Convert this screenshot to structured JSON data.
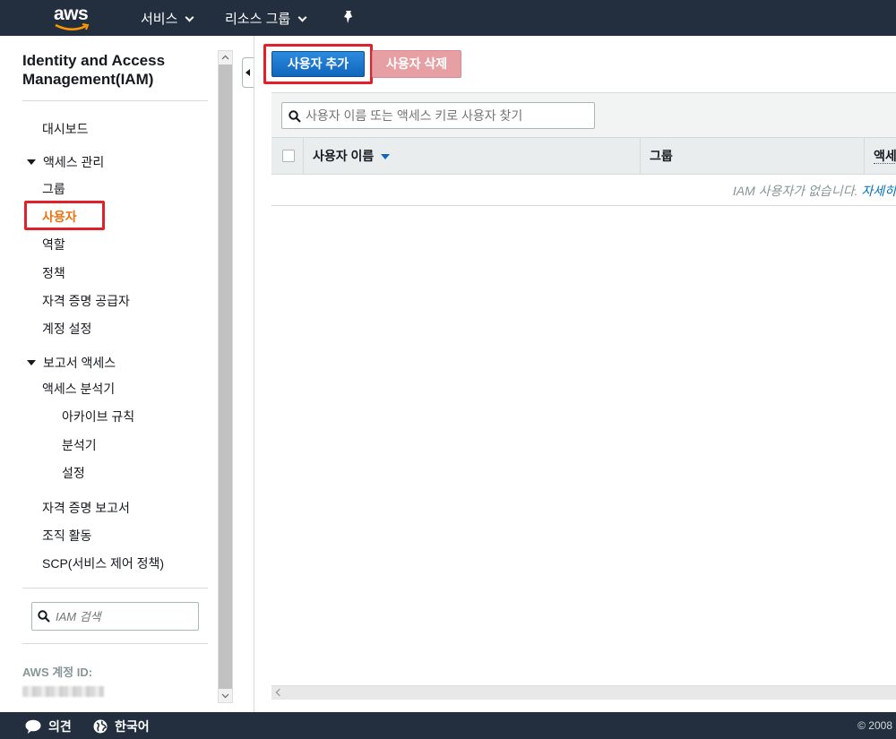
{
  "topbar": {
    "logo": "aws",
    "services": "서비스",
    "resource_groups": "리소스 그룹"
  },
  "sidebar": {
    "title": "Identity and Access Management(IAM)",
    "dashboard": "대시보드",
    "access_mgmt": "액세스 관리",
    "access_items": [
      "그룹",
      "사용자",
      "역할",
      "정책",
      "자격 증명 공급자",
      "계정 설정"
    ],
    "active_item": "사용자",
    "report_access": "보고서 액세스",
    "analyzer": "액세스 분석기",
    "analyzer_items": [
      "아카이브 규칙",
      "분석기",
      "설정"
    ],
    "credential_report": "자격 증명 보고서",
    "org_activity": "조직 활동",
    "scp": "SCP(서비스 제어 정책)",
    "search_placeholder": "IAM 검색",
    "account_id_label": "AWS 계정 ID:"
  },
  "main": {
    "add_user": "사용자 추가",
    "delete_user": "사용자 삭제",
    "search_placeholder": "사용자 이름 또는 액세스 키로 사용자 찾기",
    "columns": [
      "사용자 이름",
      "그룹",
      "액세"
    ],
    "empty_message": "IAM 사용자가 없습니다. ",
    "empty_link": "자세히"
  },
  "footer": {
    "feedback": "의견",
    "language": "한국어",
    "copyright": "© 2008"
  },
  "colors": {
    "topbar": "#232f3e",
    "active_nav": "#ec7211",
    "primary_button": "#1166bb",
    "highlight": "#e0202a",
    "link": "#0073bb"
  }
}
